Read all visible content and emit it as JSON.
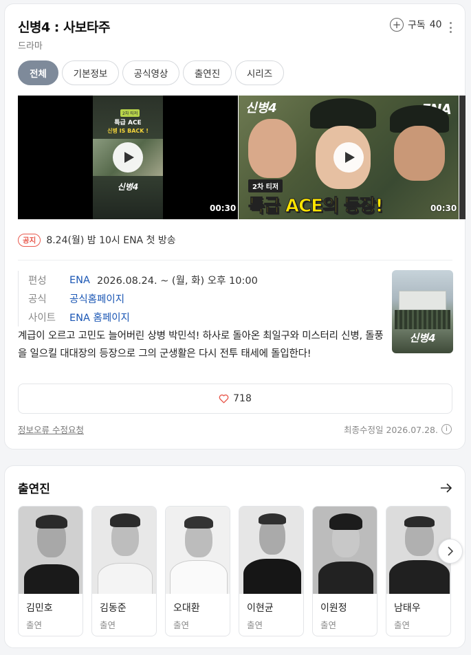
{
  "header": {
    "title": "신병4 : 사보타주",
    "subtitle": "드라마",
    "subscribe_label": "구독",
    "subscribe_count": "40"
  },
  "tabs": [
    {
      "label": "전체",
      "active": true
    },
    {
      "label": "기본정보",
      "active": false
    },
    {
      "label": "공식영상",
      "active": false
    },
    {
      "label": "출연진",
      "active": false
    },
    {
      "label": "시리즈",
      "active": false
    }
  ],
  "videos": [
    {
      "duration": "00:30",
      "badge": "2차 티저",
      "line1": "특급 ACE",
      "line2": "신병 IS BACK !",
      "logo": "신병4"
    },
    {
      "duration": "00:30",
      "logo": "신병4",
      "channel": "ENA",
      "badge": "2차 티저",
      "headline": "특급 ACE의 등장!"
    }
  ],
  "notice": {
    "badge": "공지",
    "text": "8.24(월) 밤 10시 ENA 첫 방송"
  },
  "info": [
    {
      "key": "편성",
      "value": "ENA",
      "extra": "2026.08.24. ~  (월, 화) 오후 10:00"
    },
    {
      "key": "공식",
      "value": "공식홈페이지",
      "extra": ""
    },
    {
      "key": "사이트",
      "value": "ENA 홈페이지",
      "extra": ""
    }
  ],
  "poster": {
    "logo": "신병4"
  },
  "description": "계급이 오르고 고민도 늘어버린 상병 박민석! 하사로 돌아온 최일구와 미스터리 신병, 돌풍을 일으킬 대대장의 등장으로 그의 군생활은 다시 전투 태세에 돌입한다!",
  "like_count": "718",
  "footer": {
    "report": "정보오류 수정요청",
    "updated": "최종수정일 2026.07.28."
  },
  "cast": {
    "title": "출연진",
    "members": [
      {
        "name": "김민호",
        "role": "출연"
      },
      {
        "name": "김동준",
        "role": "출연"
      },
      {
        "name": "오대환",
        "role": "출연"
      },
      {
        "name": "이현균",
        "role": "출연"
      },
      {
        "name": "이원정",
        "role": "출연"
      },
      {
        "name": "남태우",
        "role": "출연"
      }
    ]
  },
  "colors": {
    "active_tab": "#7e8a9a",
    "link": "#1a56b4",
    "notice": "#e8584c",
    "heart": "#e8584c"
  }
}
